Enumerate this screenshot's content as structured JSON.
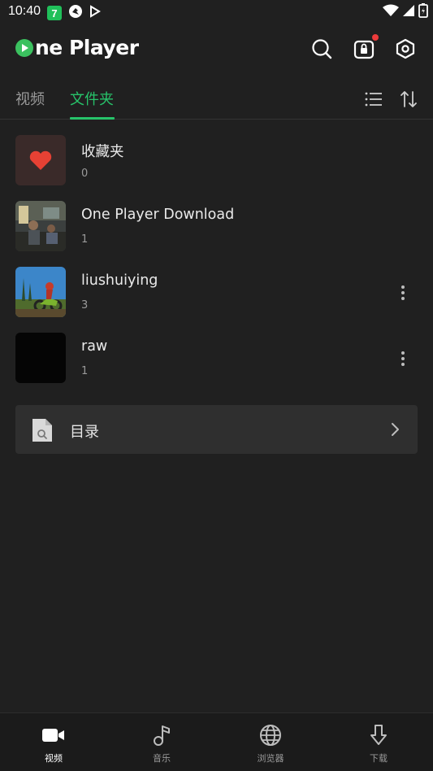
{
  "status_bar": {
    "time": "10:40",
    "badge": "7"
  },
  "header": {
    "app_name": "ne Player",
    "accent": "#27c36a"
  },
  "tabs": [
    {
      "label": "视频",
      "active": false
    },
    {
      "label": "文件夹",
      "active": true
    }
  ],
  "folders": [
    {
      "name": "收藏夹",
      "count": "0",
      "thumb": "heart-icon",
      "has_menu": false
    },
    {
      "name": "One Player Download",
      "count": "1",
      "thumb": "photo-room",
      "has_menu": false
    },
    {
      "name": "liushuiying",
      "count": "3",
      "thumb": "photo-motocross",
      "has_menu": true
    },
    {
      "name": "raw",
      "count": "1",
      "thumb": "black",
      "has_menu": true
    }
  ],
  "directory": {
    "label": "目录"
  },
  "bottom_nav": [
    {
      "label": "视频",
      "icon": "video-camera-icon",
      "active": true
    },
    {
      "label": "音乐",
      "icon": "music-note-icon",
      "active": false
    },
    {
      "label": "浏览器",
      "icon": "globe-icon",
      "active": false
    },
    {
      "label": "下载",
      "icon": "download-arrow-icon",
      "active": false
    }
  ]
}
